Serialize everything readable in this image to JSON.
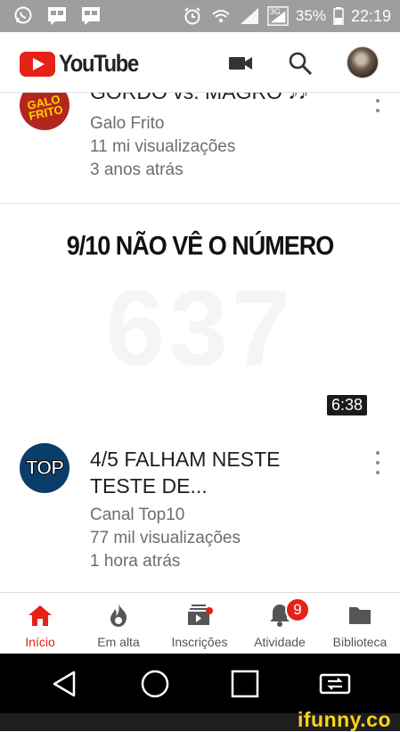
{
  "status_bar": {
    "battery": "35%",
    "time": "22:19",
    "network": "3G",
    "icons": [
      "whatsapp-icon",
      "message-icon",
      "message-icon",
      "alarm-icon",
      "wifi-icon",
      "signal-icon",
      "signal-icon",
      "battery-icon"
    ]
  },
  "app_bar": {
    "logo_text": "YouTube",
    "icons": [
      "camera-icon",
      "search-icon",
      "account-avatar"
    ]
  },
  "videos": [
    {
      "title": "GORDO vs. MAGRO ♪♪",
      "channel": "Galo Frito",
      "views": "11 mi visualizações",
      "age": "3 anos atrás",
      "avatar_text": "GALO FRITO"
    },
    {
      "thumbnail_text": "9/10 NÃO VÊ O NÚMERO",
      "thumbnail_number": "637",
      "duration": "6:38",
      "title_line1": "4/5 FALHAM NESTE",
      "title_line2": "TESTE DE...",
      "channel": "Canal Top10",
      "views": "77 mil visualizações",
      "age": "1 hora atrás",
      "avatar_text": "TOP"
    }
  ],
  "bottom_nav": {
    "items": [
      {
        "label": "Início",
        "icon": "home-icon",
        "active": true
      },
      {
        "label": "Em alta",
        "icon": "flame-icon",
        "active": false
      },
      {
        "label": "Inscrições",
        "icon": "subscriptions-icon",
        "active": false
      },
      {
        "label": "Atividade",
        "icon": "bell-icon",
        "active": false
      },
      {
        "label": "Biblioteca",
        "icon": "folder-icon",
        "active": false
      }
    ],
    "activity_badge": "9"
  },
  "colors": {
    "accent": "#e62117",
    "status_bar": "#9e9e9e",
    "watermark": "#ffd417"
  },
  "watermark": "ifunny.co"
}
